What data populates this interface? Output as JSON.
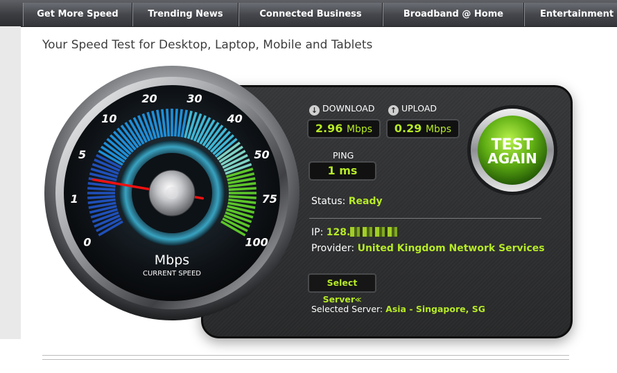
{
  "nav": {
    "items": [
      {
        "label": "Get More Speed"
      },
      {
        "label": "Trending News"
      },
      {
        "label": "Connected Business"
      },
      {
        "label": "Broadband @ Home"
      },
      {
        "label": "Entertainment"
      }
    ]
  },
  "page": {
    "title": "Your Speed Test for Desktop, Laptop, Mobile and Tablets"
  },
  "gauge": {
    "scale_labels": [
      "0",
      "1",
      "5",
      "10",
      "20",
      "30",
      "40",
      "50",
      "75",
      "100"
    ],
    "unit_label": "Mbps",
    "caption": "CURRENT SPEED",
    "needle_speed_mbps": 2.96
  },
  "results": {
    "download_label": "DOWNLOAD",
    "download_value": "2.96",
    "download_unit": "Mbps",
    "upload_label": "UPLOAD",
    "upload_value": "0.29",
    "upload_unit": "Mbps",
    "ping_label": "PING",
    "ping_value": "1 ms"
  },
  "test_button": {
    "line1": "TEST",
    "line2": "AGAIN"
  },
  "status": {
    "label": "Status:",
    "value": "Ready"
  },
  "connection": {
    "ip_label": "IP:",
    "ip_value": "128.",
    "provider_label": "Provider:",
    "provider_value": "United Kingdom Network Services"
  },
  "server": {
    "select_label": "Select Server",
    "selected_label": "Selected Server:",
    "selected_value": "Asia - Singapore, SG"
  },
  "colors": {
    "accent_green": "#b6ea26",
    "panel_bg": "#2e2f31",
    "gauge_blue": "#1e8ed8",
    "gauge_green": "#5cc52a",
    "needle_red": "#ee1111"
  },
  "icons": {
    "download": "arrow-down-circle-icon",
    "upload": "arrow-up-circle-icon",
    "select": "chevron-double-down-icon"
  }
}
